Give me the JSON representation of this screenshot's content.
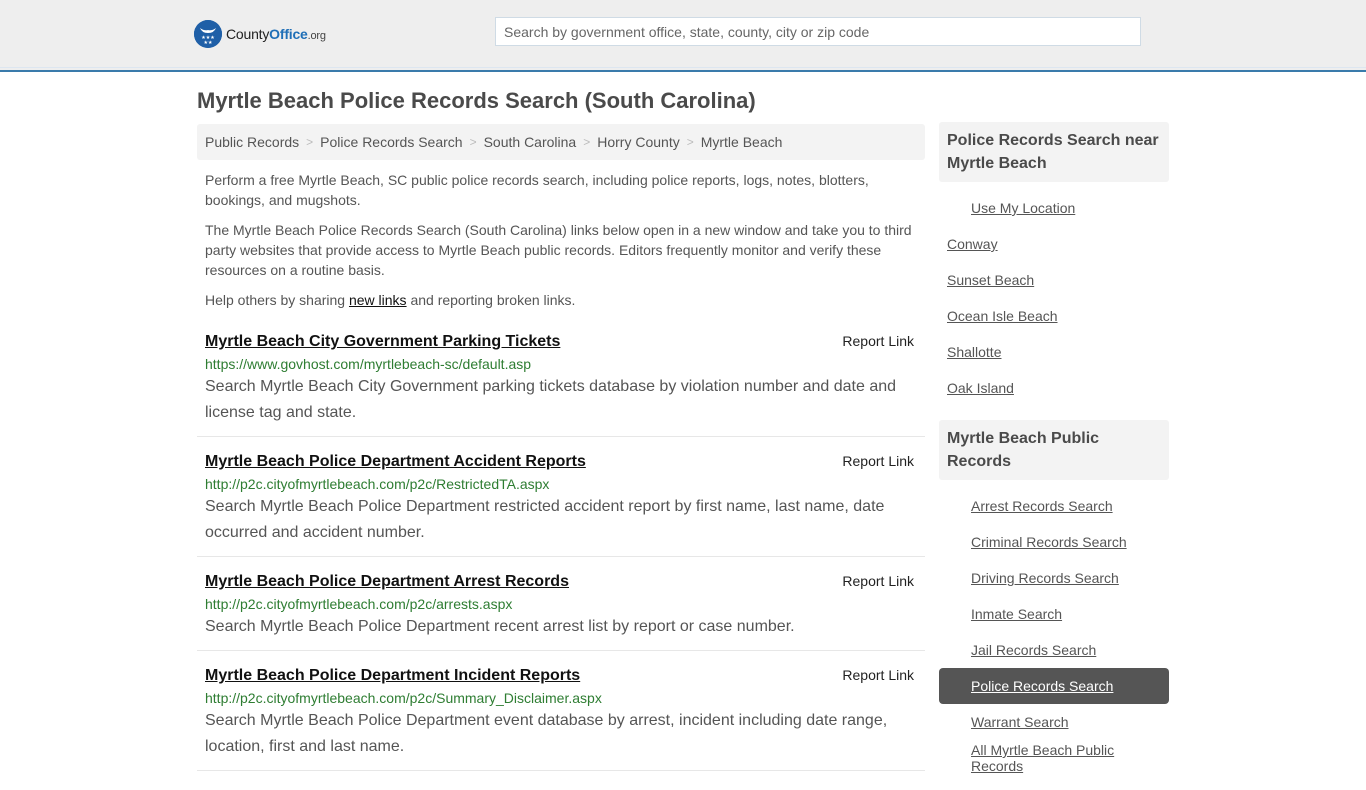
{
  "header": {
    "logo": {
      "icon": "eagle-stars-badge-icon",
      "brand_part1": "County",
      "brand_part2": "Office",
      "brand_part3": ".org",
      "brand_color": "#1f5fa7"
    },
    "search": {
      "placeholder": "Search by government office, state, county, city or zip code",
      "value": ""
    },
    "accent_color": "#3a7bab"
  },
  "page": {
    "title": "Myrtle Beach Police Records Search (South Carolina)"
  },
  "breadcrumb": [
    {
      "label": "Public Records"
    },
    {
      "label": "Police Records Search"
    },
    {
      "label": "South Carolina"
    },
    {
      "label": "Horry County"
    },
    {
      "label": "Myrtle Beach"
    }
  ],
  "intro": {
    "p1": "Perform a free Myrtle Beach, SC public police records search, including police reports, logs, notes, blotters, bookings, and mugshots.",
    "p2": "The Myrtle Beach Police Records Search (South Carolina) links below open in a new window and take you to third party websites that provide access to Myrtle Beach public records. Editors frequently monitor and verify these resources on a routine basis.",
    "p3_before": "Help others by sharing ",
    "p3_link": "new links",
    "p3_after": " and reporting broken links."
  },
  "results": [
    {
      "title": "Myrtle Beach City Government Parking Tickets",
      "report_label": "Report Link",
      "url": "https://www.govhost.com/myrtlebeach-sc/default.asp",
      "description": "Search Myrtle Beach City Government parking tickets database by violation number and date and license tag and state."
    },
    {
      "title": "Myrtle Beach Police Department Accident Reports",
      "report_label": "Report Link",
      "url": "http://p2c.cityofmyrtlebeach.com/p2c/RestrictedTA.aspx",
      "description": "Search Myrtle Beach Police Department restricted accident report by first name, last name, date occurred and accident number."
    },
    {
      "title": "Myrtle Beach Police Department Arrest Records",
      "report_label": "Report Link",
      "url": "http://p2c.cityofmyrtlebeach.com/p2c/arrests.aspx",
      "description": "Search Myrtle Beach Police Department recent arrest list by report or case number."
    },
    {
      "title": "Myrtle Beach Police Department Incident Reports",
      "report_label": "Report Link",
      "url": "http://p2c.cityofmyrtlebeach.com/p2c/Summary_Disclaimer.aspx",
      "description": "Search Myrtle Beach Police Department event database by arrest, incident including date range, location, first and last name."
    }
  ],
  "sidebar": {
    "nearby": {
      "heading": "Police Records Search near Myrtle Beach",
      "use_location": "Use My Location",
      "items": [
        {
          "label": "Conway"
        },
        {
          "label": "Sunset Beach"
        },
        {
          "label": "Ocean Isle Beach"
        },
        {
          "label": "Shallotte"
        },
        {
          "label": "Oak Island"
        }
      ]
    },
    "public_records": {
      "heading": "Myrtle Beach Public Records",
      "items": [
        {
          "label": "Arrest Records Search",
          "active": false
        },
        {
          "label": "Criminal Records Search",
          "active": false
        },
        {
          "label": "Driving Records Search",
          "active": false
        },
        {
          "label": "Inmate Search",
          "active": false
        },
        {
          "label": "Jail Records Search",
          "active": false
        },
        {
          "label": "Police Records Search",
          "active": true
        },
        {
          "label": "Warrant Search",
          "active": false
        },
        {
          "label": "All Myrtle Beach Public Records",
          "active": false
        }
      ]
    }
  }
}
